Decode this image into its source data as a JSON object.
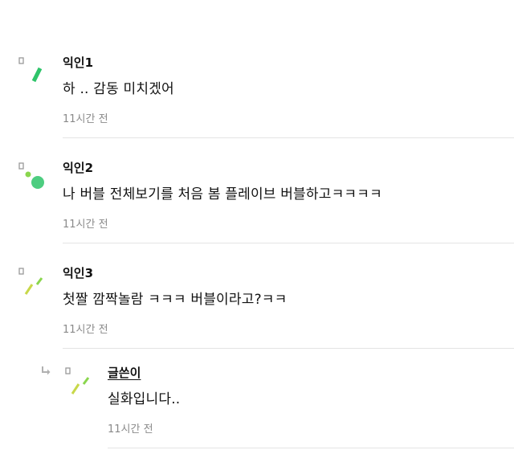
{
  "comments": [
    {
      "author": "익인1",
      "text": "하 .. 감동 미치겠어",
      "time": "11시간 전",
      "avatar": "green-slash-avatar-icon"
    },
    {
      "author": "익인2",
      "text": "나 버블 전체보기를 처음 봄 플레이브 버블하고ㅋㅋㅋㅋ",
      "time": "11시간 전",
      "avatar": "green-dots-avatar-icon"
    },
    {
      "author": "익인3",
      "text": "첫짤 깜짝놀람 ㅋㅋㅋ 버블이라고?ㅋㅋ",
      "time": "11시간 전",
      "avatar": "yellow-green-ticks-avatar-icon"
    }
  ],
  "reply": {
    "author": "글쓴이",
    "text": "실화입니다..",
    "time": "11시간 전",
    "avatar": "yellow-green-ticks-avatar-icon",
    "arrow_icon": "reply-arrow-icon"
  },
  "colors": {
    "green": "#2ec46a",
    "lime": "#b9d64a",
    "light_green": "#8ad64e",
    "muted_text": "#8a8a8a",
    "divider": "#e4e4e4"
  }
}
